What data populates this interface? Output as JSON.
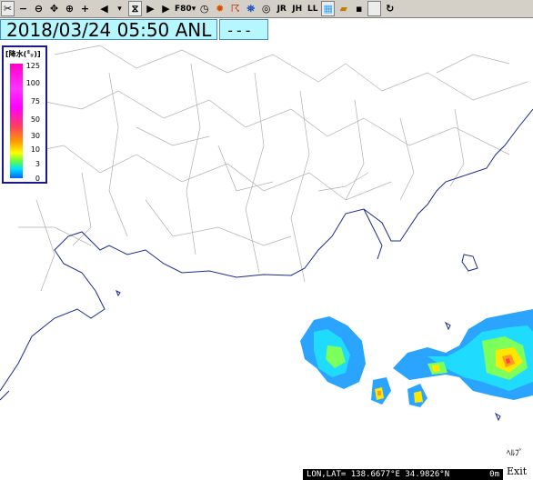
{
  "toolbar": {
    "zoom_level": "F80",
    "buttons": [
      "scissors-icon",
      "zoom-out-icon",
      "zoom-out-circle-icon",
      "pan-icon",
      "target-icon",
      "zoom-in-icon",
      "prev-icon",
      "pause-icon",
      "next-icon",
      "play-icon",
      "dropdown-icon",
      "clock-icon",
      "sun-icon",
      "typhoon-icon",
      "satellite-icon",
      "circle-icon"
    ],
    "jr_label": "JR",
    "jh_label": "JH",
    "ll_label": "LL"
  },
  "time_bar": {
    "datetime": "2018/03/24 05:50 ANL",
    "status": "---"
  },
  "legend": {
    "title": "[降水(㍉)]",
    "labels": [
      "125",
      "100",
      "75",
      "50",
      "30",
      "10",
      "3",
      "0"
    ]
  },
  "controls": {
    "help_label": "ﾍﾙﾌﾟ",
    "exit_label": "Exit"
  },
  "status_bar": {
    "coordinates": "LON,LAT= 138.6677°E  34.9826°N",
    "elevation": "0m"
  }
}
